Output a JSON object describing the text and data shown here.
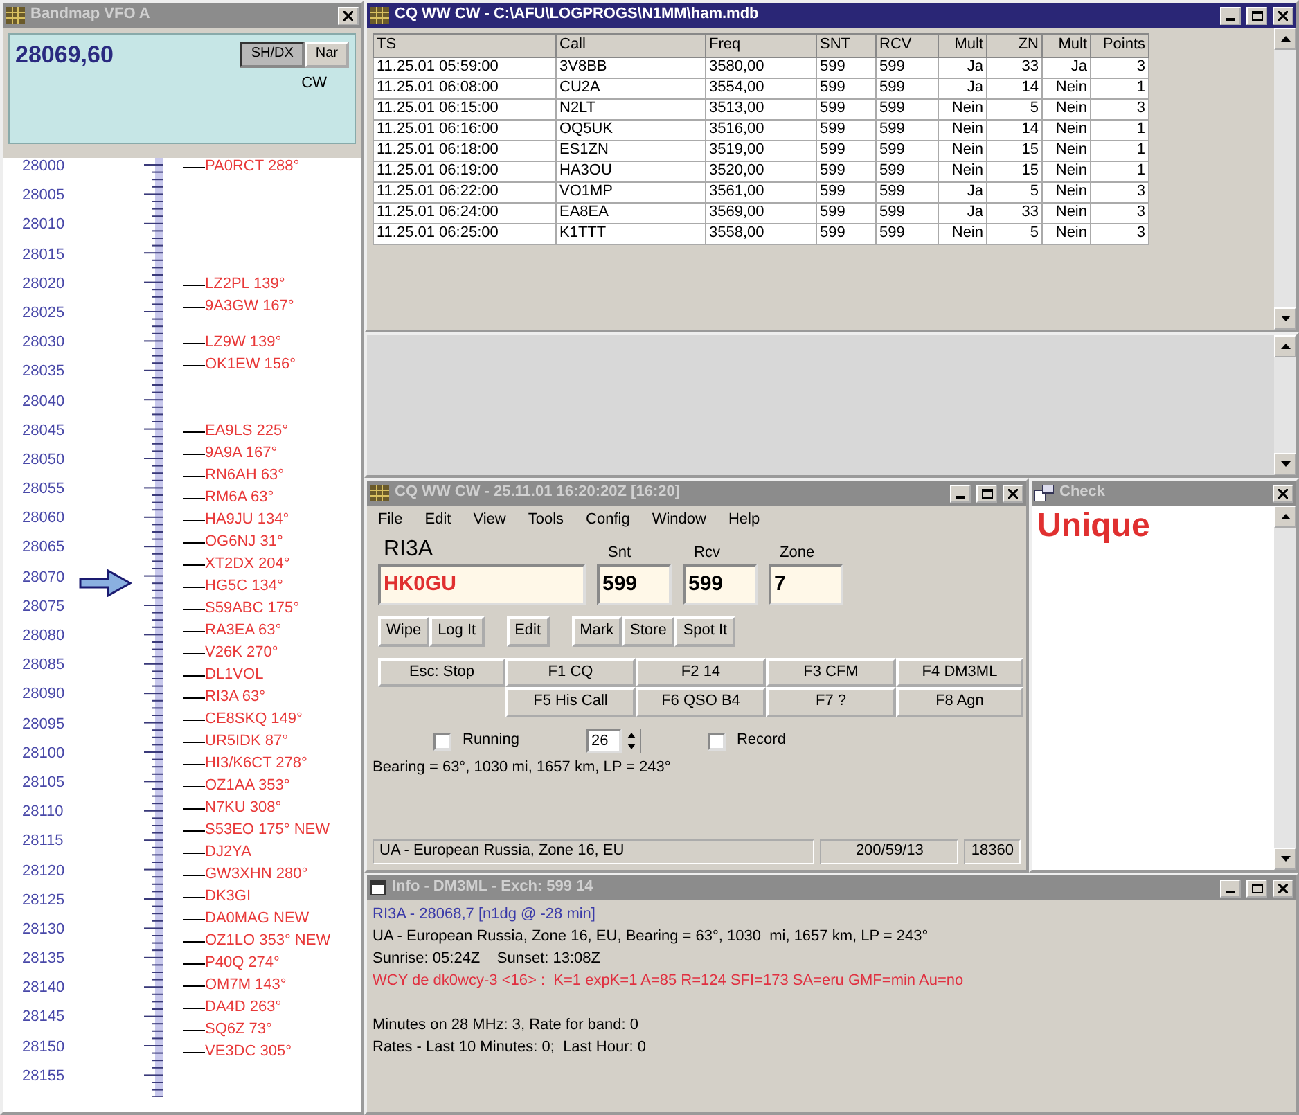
{
  "bandmap": {
    "title": "Bandmap VFO A",
    "active": false,
    "frequency": "28069,60",
    "buttons": [
      {
        "label": "SH/DX",
        "pressed": true
      },
      {
        "label": "Nar",
        "pressed": false
      }
    ],
    "mode": "CW",
    "rows": [
      {
        "label": "28000",
        "current": false,
        "spots": [
          "PA0RCT 288°"
        ]
      },
      {
        "label": "28005",
        "current": false
      },
      {
        "label": "28010",
        "current": false
      },
      {
        "label": "28015",
        "current": false
      },
      {
        "label": "28020",
        "current": false,
        "spots": [
          "LZ2PL 139°",
          "9A3GW 167°"
        ]
      },
      {
        "label": "28025",
        "current": false
      },
      {
        "label": "28030",
        "current": false,
        "spots": [
          "LZ9W 139°",
          "OK1EW 156°"
        ]
      },
      {
        "label": "28035",
        "current": false
      },
      {
        "label": "28040",
        "current": false
      },
      {
        "label": "28045",
        "current": false,
        "spots": [
          "EA9LS 225°",
          "9A9A 167°",
          "RN6AH 63°",
          "RM6A 63°",
          "HA9JU 134°",
          "OG6NJ 31°",
          "XT2DX 204°",
          "HG5C 134°",
          "S59ABC 175°",
          "RA3EA 63°",
          "V26K 270°",
          "DL1VOL",
          "RI3A 63°",
          "CE8SKQ 149°",
          "UR5IDK 87°",
          "HI3/K6CT 278°",
          "OZ1AA 353°",
          "N7KU 308°",
          "S53EO 175° NEW",
          "DJ2YA",
          "GW3XHN 280°",
          "DK3GI",
          "DA0MAG NEW",
          "OZ1LO 353° NEW",
          "P40Q 274°",
          "OM7M 143°",
          "DA4D 263°",
          "SQ6Z 73°",
          "VE3DC 305°"
        ]
      },
      {
        "label": "28050",
        "current": false
      },
      {
        "label": "28055",
        "current": false
      },
      {
        "label": "28060",
        "current": false
      },
      {
        "label": "28065",
        "current": false
      },
      {
        "label": "28070",
        "current": true
      },
      {
        "label": "28075",
        "current": false
      },
      {
        "label": "28080",
        "current": false
      },
      {
        "label": "28085",
        "current": false
      },
      {
        "label": "28090",
        "current": false
      },
      {
        "label": "28095",
        "current": false
      },
      {
        "label": "28100",
        "current": false
      },
      {
        "label": "28105",
        "current": false
      },
      {
        "label": "28110",
        "current": false
      },
      {
        "label": "28115",
        "current": false
      },
      {
        "label": "28120",
        "current": false
      },
      {
        "label": "28125",
        "current": false
      },
      {
        "label": "28130",
        "current": false
      },
      {
        "label": "28135",
        "current": false
      },
      {
        "label": "28140",
        "current": false
      },
      {
        "label": "28145",
        "current": false
      },
      {
        "label": "28150",
        "current": false
      },
      {
        "label": "28155",
        "current": false
      }
    ]
  },
  "log": {
    "title": "CQ WW CW - C:\\AFU\\LOGPROGS\\N1MM\\ham.mdb",
    "active": true,
    "columns": [
      "TS",
      "Call",
      "Freq",
      "SNT",
      "RCV",
      "Mult",
      "ZN",
      "Mult",
      "Points"
    ],
    "rows": [
      [
        "11.25.01 05:59:00",
        "3V8BB",
        "3580,00",
        "599",
        "599",
        "Ja",
        "33",
        "Ja",
        "3"
      ],
      [
        "11.25.01 06:08:00",
        "CU2A",
        "3554,00",
        "599",
        "599",
        "Ja",
        "14",
        "Nein",
        "1"
      ],
      [
        "11.25.01 06:15:00",
        "N2LT",
        "3513,00",
        "599",
        "599",
        "Nein",
        "5",
        "Nein",
        "3"
      ],
      [
        "11.25.01 06:16:00",
        "OQ5UK",
        "3516,00",
        "599",
        "599",
        "Nein",
        "14",
        "Nein",
        "1"
      ],
      [
        "11.25.01 06:18:00",
        "ES1ZN",
        "3519,00",
        "599",
        "599",
        "Nein",
        "15",
        "Nein",
        "1"
      ],
      [
        "11.25.01 06:19:00",
        "HA3OU",
        "3520,00",
        "599",
        "599",
        "Nein",
        "15",
        "Nein",
        "1"
      ],
      [
        "11.25.01 06:22:00",
        "VO1MP",
        "3561,00",
        "599",
        "599",
        "Ja",
        "5",
        "Nein",
        "3"
      ],
      [
        "11.25.01 06:24:00",
        "EA8EA",
        "3569,00",
        "599",
        "599",
        "Ja",
        "33",
        "Nein",
        "3"
      ],
      [
        "11.25.01 06:25:00",
        "K1TTT",
        "3558,00",
        "599",
        "599",
        "Nein",
        "5",
        "Nein",
        "3"
      ]
    ]
  },
  "entry": {
    "title": "CQ WW CW - 25.11.01 16:20:20Z [16:20]",
    "active": false,
    "menu": [
      "File",
      "Edit",
      "View",
      "Tools",
      "Config",
      "Window",
      "Help"
    ],
    "call_label": "RI3A",
    "call": "HK0GU",
    "fields": [
      {
        "label": "Snt",
        "value": "599"
      },
      {
        "label": "Rcv",
        "value": "599"
      },
      {
        "label": "Zone",
        "value": "7"
      }
    ],
    "buttons": [
      [
        "Wipe",
        "Log It"
      ],
      [
        "Edit"
      ],
      [
        "Mark",
        "Store",
        "Spot It"
      ]
    ],
    "fkeys": [
      [
        "Esc: Stop",
        "F1 CQ",
        "F2 14",
        "F3 CFM",
        "F4 DM3ML"
      ],
      [
        "F5 His Call",
        "F6 QSO B4",
        "F7 ?",
        "F8 Agn"
      ]
    ],
    "options": [
      {
        "kind": "checkbox",
        "label": "Running",
        "checked": false
      },
      {
        "kind": "spinner",
        "value": "26"
      },
      {
        "kind": "checkbox",
        "label": "Record",
        "checked": false
      }
    ],
    "bearing": "Bearing = 63°, 1030  mi, 1657 km, LP = 243°",
    "status": [
      "UA - European Russia, Zone 16, EU",
      "200/59/13",
      "18360"
    ]
  },
  "check": {
    "title": "Check",
    "active": false,
    "result": "Unique"
  },
  "info": {
    "title": "Info - DM3ML - Exch: 599 14",
    "active": false,
    "lines": [
      {
        "kind": "spot",
        "text": "RI3A - 28068,7 [n1dg @ -28 min]"
      },
      {
        "kind": "normal",
        "text": "UA - European Russia, Zone 16, EU, Bearing = 63°, 1030  mi, 1657 km, LP = 243°"
      },
      {
        "kind": "normal",
        "text": "Sunrise: 05:24Z    Sunset: 13:08Z"
      },
      {
        "kind": "alert",
        "text": "WCY de dk0wcy-3 <16> :  K=1 expK=1 A=85 R=124 SFI=173 SA=eru GMF=min Au=no"
      },
      {
        "kind": "blank"
      },
      {
        "kind": "normal",
        "text": "Minutes on 28 MHz: 3, Rate for band: 0"
      },
      {
        "kind": "normal",
        "text": "Rates - Last 10 Minutes: 0;  Last Hour: 0"
      }
    ]
  }
}
